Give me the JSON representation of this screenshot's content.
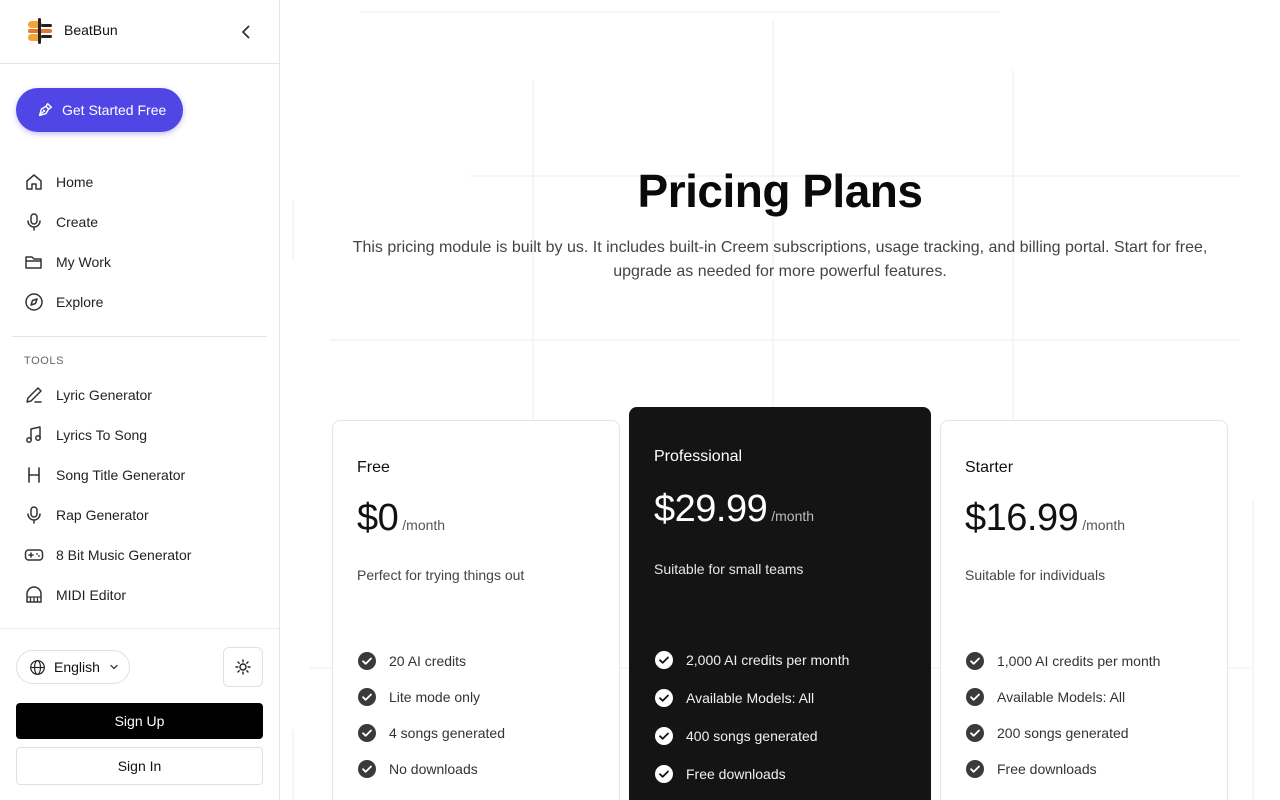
{
  "brand": {
    "name": "BeatBun"
  },
  "cta": {
    "label": "Get Started Free"
  },
  "nav": [
    {
      "label": "Home",
      "icon": "home-icon"
    },
    {
      "label": "Create",
      "icon": "microphone-icon"
    },
    {
      "label": "My Work",
      "icon": "folder-icon"
    },
    {
      "label": "Explore",
      "icon": "compass-icon"
    }
  ],
  "tools": {
    "heading": "TOOLS",
    "items": [
      {
        "label": "Lyric Generator",
        "icon": "pen-icon"
      },
      {
        "label": "Lyrics To Song",
        "icon": "music-note-icon"
      },
      {
        "label": "Song Title Generator",
        "icon": "heading-icon"
      },
      {
        "label": "Rap Generator",
        "icon": "microphone-icon"
      },
      {
        "label": "8 Bit Music Generator",
        "icon": "gamepad-icon"
      },
      {
        "label": "MIDI Editor",
        "icon": "piano-icon"
      }
    ]
  },
  "footer": {
    "language": "English",
    "signup": "Sign Up",
    "signin": "Sign In"
  },
  "pricing": {
    "title": "Pricing Plans",
    "subtitle": "This pricing module is built by us. It includes built-in Creem subscriptions, usage tracking, and billing portal. Start for free, upgrade as needed for more powerful features.",
    "plans": [
      {
        "name": "Free",
        "price": "$0",
        "period": "/month",
        "description": "Perfect for trying things out",
        "features": [
          "20 AI credits",
          "Lite mode only",
          "4 songs generated",
          "No downloads"
        ]
      },
      {
        "name": "Professional",
        "price": "$29.99",
        "period": "/month",
        "description": "Suitable for small teams",
        "features": [
          "2,000 AI credits per month",
          "Available Models: All",
          "400 songs generated",
          "Free downloads"
        ]
      },
      {
        "name": "Starter",
        "price": "$16.99",
        "period": "/month",
        "description": "Suitable for individuals",
        "features": [
          "1,000 AI credits per month",
          "Available Models: All",
          "200 songs generated",
          "Free downloads"
        ]
      }
    ]
  },
  "colors": {
    "accent": "#4f46e5",
    "featured_card": "#141414"
  }
}
